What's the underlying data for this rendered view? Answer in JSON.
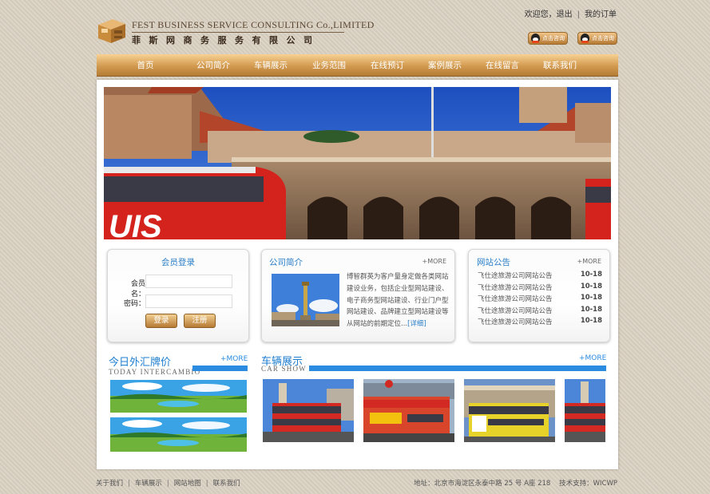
{
  "header": {
    "logo_en": "FEST BUSINESS SERVICE CONSULTING Co.,LIMITED",
    "logo_cn": "菲斯网商务服务有限公司",
    "top_links": {
      "welcome": "欢迎您，",
      "logout": "退出",
      "orders": "我的订单"
    },
    "qq_buttons": [
      "点击咨询",
      "点击咨询"
    ]
  },
  "nav": {
    "items": [
      "首页",
      "公司简介",
      "车辆展示",
      "业务范围",
      "在线预订",
      "案例展示",
      "在线留言",
      "联系我们"
    ]
  },
  "login": {
    "title": "会员登录",
    "username_label": "会员名：",
    "password_label": "密码：",
    "login_button": "登录",
    "register_button": "注册"
  },
  "intro": {
    "title": "公司简介",
    "more": "+MORE",
    "text": "博智群英为客户量身定做各类网站建设业务，包括企业型网站建设、电子商务型网站建设、行业门户型网站建设、品牌建立型网站建设等从网站的前期定位...",
    "detail": "[详细]"
  },
  "notice": {
    "title": "网站公告",
    "more": "+MORE",
    "items": [
      {
        "text": "飞仕途旅游公司网站公告",
        "date": "10-18"
      },
      {
        "text": "飞仕途旅游公司网站公告",
        "date": "10-18"
      },
      {
        "text": "飞仕途旅游公司网站公告",
        "date": "10-18"
      },
      {
        "text": "飞仕途旅游公司网站公告",
        "date": "10-18"
      },
      {
        "text": "飞仕途旅游公司网站公告",
        "date": "10-18"
      }
    ]
  },
  "exchange": {
    "title": "今日外汇牌价",
    "subtitle": "TODAY INTERCAMBIO",
    "more": "+MORE"
  },
  "vehicles": {
    "title": "车辆展示",
    "subtitle": "CAR SHOW",
    "more": "+MORE"
  },
  "footer": {
    "links": [
      "关于我们",
      "车辆展示",
      "网站地图",
      "联系我们"
    ],
    "info": "地址：北京市海淀区永泰中路 25 号 A座 218    技术支持：WICWP"
  },
  "colors": {
    "nav_gold": "#c8914a",
    "accent_blue": "#2a8be0",
    "page_bg": "#d9d0c1"
  }
}
